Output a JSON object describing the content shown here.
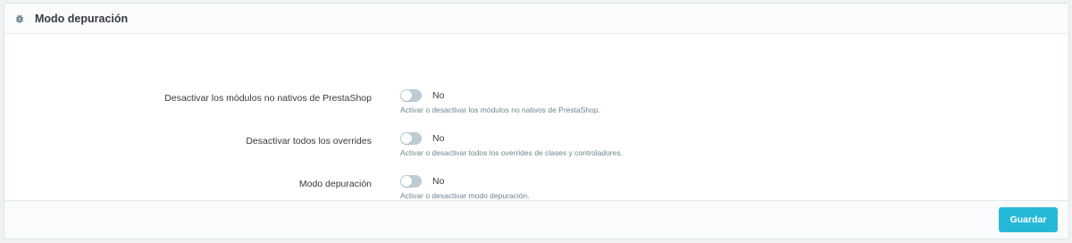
{
  "panel": {
    "title": "Modo depuración",
    "icon": "bug-icon"
  },
  "settings": [
    {
      "label": "Desactivar los módulos no nativos de PrestaShop",
      "value": "No",
      "help": "Activar o desactivar los módulos no nativos de PrestaShop."
    },
    {
      "label": "Desactivar todos los overrides",
      "value": "No",
      "help": "Activar o desactivar todos los overrides de clases y controladores."
    },
    {
      "label": "Modo depuración",
      "value": "No",
      "help": "Activar o desactivar modo depuración."
    }
  ],
  "footer": {
    "save_label": "Guardar"
  },
  "colors": {
    "accent": "#25b9d7",
    "switch_off": "#bbcdd2"
  }
}
